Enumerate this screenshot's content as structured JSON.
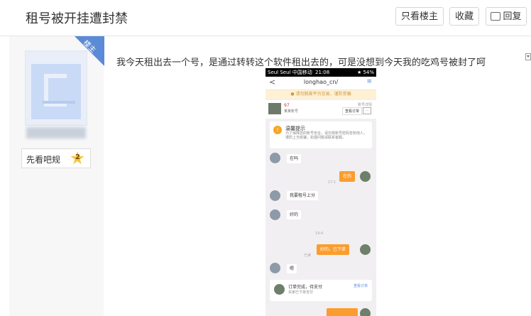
{
  "header": {
    "title": "租号被开挂遭封禁",
    "btn_owner_only": "只看楼主",
    "btn_favorite": "收藏",
    "btn_reply": "回复"
  },
  "author": {
    "badge": "楼主",
    "rules_label": "先看吧规",
    "level": "2"
  },
  "post": {
    "text": "我今天租出去一个号，是通过转转这个软件租出去的，可是没想到今天我的吃鸡号被封了呵"
  },
  "phone": {
    "status_left": "Seul Seul 中国移动",
    "status_time": "21:08",
    "status_right": "★ 54%",
    "nav_back": "<",
    "nav_title": "longhao_cn/",
    "nav_more": "≡",
    "notice": "● 请勿脱离平台交易，谨防受骗",
    "user_name": "97",
    "user_sub": "某某账号",
    "user_right": "账号详情",
    "user_btn": "查看订单",
    "user_dots": "...",
    "tip_title": "温馨提示",
    "tip_body": "为了保障您的账号安全，请勿将账号密码告知他人，谨防上当受骗，如遇问题请联系客服。",
    "msg1": "在吗",
    "time1": "17:1",
    "msg2_out": "在的",
    "msg3": "我要租号上分",
    "msg4": "好的",
    "time2": "19:4",
    "time3": "已读",
    "msg5_out": "好的，已下单",
    "msg6": "嗯",
    "order_title": "订单完成，待支付",
    "order_sub": "买家已下单支付",
    "order_link": "查看订单"
  }
}
